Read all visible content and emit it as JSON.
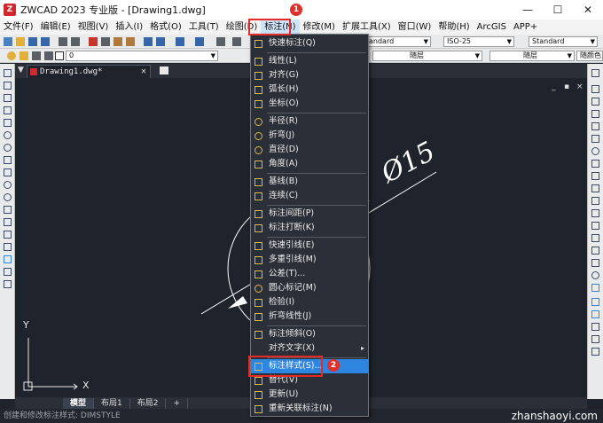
{
  "window": {
    "app_icon_text": "Z",
    "title": "ZWCAD 2023 专业版 - [Drawing1.dwg]",
    "minimize_glyph": "—",
    "maximize_glyph": "☐",
    "close_glyph": "✕"
  },
  "menubar": {
    "items": [
      "文件(F)",
      "编辑(E)",
      "视图(V)",
      "插入(I)",
      "格式(O)",
      "工具(T)",
      "绘图(D)",
      "标注(N)",
      "修改(M)",
      "扩展工具(X)",
      "窗口(W)",
      "帮助(H)",
      "ArcGIS",
      "APP+"
    ]
  },
  "toolbar": {
    "dimstyle_value": "andard",
    "textstyle_value": "ISO-25",
    "tablestyle_value": "Standard",
    "layer_value": "0",
    "linetype_value": "随层",
    "lineweight_value": "随层",
    "color_value": "随颜色"
  },
  "document_tab": {
    "label": "Drawing1.dwg*",
    "close_glyph": "✕"
  },
  "viewport_controls": {
    "min": "_",
    "restore": "▪",
    "close": "×"
  },
  "drawing": {
    "dimension_text": "Ø15",
    "ucs_y": "Y",
    "ucs_x": "X"
  },
  "layout_tabs": [
    "模型",
    "布局1",
    "布局2",
    "+"
  ],
  "statusbar": {
    "prompt": "创建和修改标注样式: DIMSTYLE",
    "watermark": "zhanshaoyi.com"
  },
  "dropdown": {
    "items": [
      {
        "label": "快速标注(Q)"
      },
      {
        "label": "线性(L)"
      },
      {
        "label": "对齐(G)"
      },
      {
        "label": "弧长(H)"
      },
      {
        "label": "坐标(O)"
      },
      {
        "label": "半径(R)"
      },
      {
        "label": "折弯(J)"
      },
      {
        "label": "直径(D)"
      },
      {
        "label": "角度(A)"
      },
      {
        "label": "基线(B)"
      },
      {
        "label": "连续(C)"
      },
      {
        "label": "标注间距(P)"
      },
      {
        "label": "标注打断(K)"
      },
      {
        "label": "快速引线(E)"
      },
      {
        "label": "多重引线(M)"
      },
      {
        "label": "公差(T)..."
      },
      {
        "label": "圆心标记(M)"
      },
      {
        "label": "检验(I)"
      },
      {
        "label": "折弯线性(J)"
      },
      {
        "label": "标注倾斜(O)"
      },
      {
        "label": "对齐文字(X)"
      },
      {
        "label": "标注样式(S)..."
      },
      {
        "label": "替代(V)"
      },
      {
        "label": "更新(U)"
      },
      {
        "label": "重新关联标注(N)"
      }
    ],
    "submenu_glyph": "▸"
  },
  "annotations": {
    "badge_1": "1",
    "badge_2": "2"
  },
  "colors": {
    "highlight": "#2f86e1",
    "annotation_red": "#e52b28",
    "canvas": "#1f232b"
  }
}
